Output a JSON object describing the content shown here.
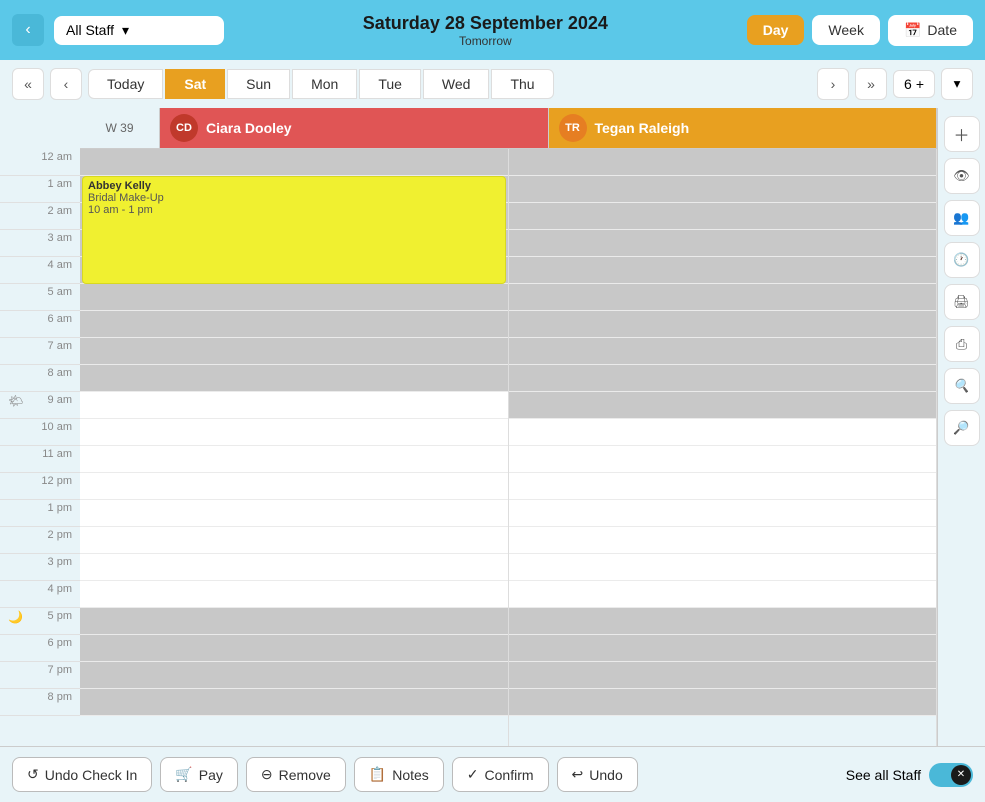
{
  "header": {
    "back_label": "‹",
    "staff_dropdown": "All Staff",
    "title": "Saturday 28 September 2024",
    "subtitle": "Tomorrow",
    "day_label": "Day",
    "week_label": "Week",
    "date_label": "Date",
    "date_icon": "📅"
  },
  "toolbar": {
    "nav_prev_prev": "«",
    "nav_prev": "‹",
    "today_label": "Today",
    "days": [
      {
        "label": "Sat",
        "active": true
      },
      {
        "label": "Sun",
        "active": false
      },
      {
        "label": "Mon",
        "active": false
      },
      {
        "label": "Tue",
        "active": false
      },
      {
        "label": "Wed",
        "active": false
      },
      {
        "label": "Thu",
        "active": false
      }
    ],
    "nav_next": "›",
    "nav_next_next": "»",
    "count": "6",
    "count_plus": "+",
    "chevron_down": "▾"
  },
  "staff": [
    {
      "name": "Ciara Dooley",
      "color": "red",
      "initials": "CD"
    },
    {
      "name": "Tegan Raleigh",
      "color": "orange",
      "initials": "TR"
    }
  ],
  "time_slots": [
    {
      "label": "12 am",
      "icon": ""
    },
    {
      "label": "1 am",
      "icon": ""
    },
    {
      "label": "2 am",
      "icon": ""
    },
    {
      "label": "3 am",
      "icon": ""
    },
    {
      "label": "4 am",
      "icon": ""
    },
    {
      "label": "5 am",
      "icon": ""
    },
    {
      "label": "6 am",
      "icon": ""
    },
    {
      "label": "7 am",
      "icon": ""
    },
    {
      "label": "8 am",
      "icon": ""
    },
    {
      "label": "9 am",
      "icon": "🌤"
    },
    {
      "label": "10 am",
      "icon": ""
    },
    {
      "label": "11 am",
      "icon": ""
    },
    {
      "label": "12 pm",
      "icon": ""
    },
    {
      "label": "1 pm",
      "icon": ""
    },
    {
      "label": "2 pm",
      "icon": ""
    },
    {
      "label": "3 pm",
      "icon": ""
    },
    {
      "label": "4 pm",
      "icon": ""
    },
    {
      "label": "5 pm",
      "icon": "🌙"
    },
    {
      "label": "6 pm",
      "icon": ""
    },
    {
      "label": "7 pm",
      "icon": ""
    },
    {
      "label": "8 pm",
      "icon": ""
    }
  ],
  "appointment": {
    "client": "Abbey Kelly",
    "service": "Bridal Make-Up",
    "time": "10 am - 1 pm"
  },
  "sidebar_icons": [
    {
      "name": "add-icon",
      "symbol": "＋"
    },
    {
      "name": "hide-icon",
      "symbol": "👁"
    },
    {
      "name": "people-icon",
      "symbol": "👥"
    },
    {
      "name": "clock-icon",
      "symbol": "🕐"
    },
    {
      "name": "print-icon",
      "symbol": "🖨"
    },
    {
      "name": "share-icon",
      "symbol": "⎙"
    },
    {
      "name": "zoom-out-icon",
      "symbol": "🔍"
    },
    {
      "name": "zoom-in-icon",
      "symbol": "🔎"
    }
  ],
  "bottom_bar": {
    "undo_checkin": "Undo Check In",
    "pay": "Pay",
    "remove": "Remove",
    "notes": "Notes",
    "confirm": "Confirm",
    "undo": "Undo",
    "see_all_staff": "See all Staff"
  },
  "week_label": "W 39"
}
